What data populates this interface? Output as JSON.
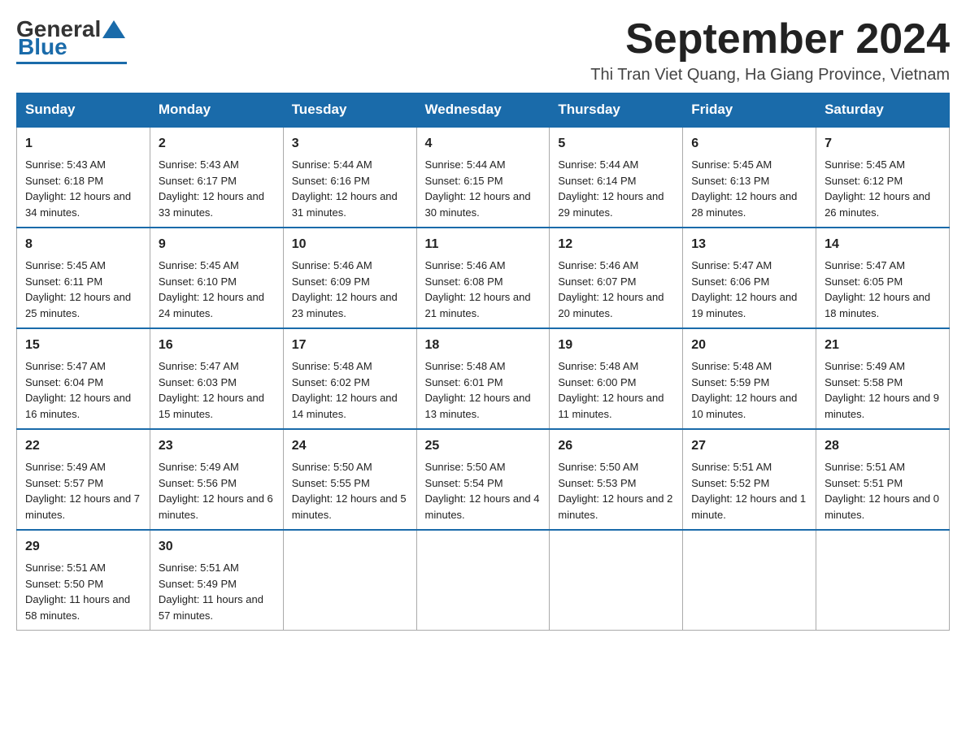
{
  "logo": {
    "general": "General",
    "blue": "Blue"
  },
  "header": {
    "month": "September 2024",
    "location": "Thi Tran Viet Quang, Ha Giang Province, Vietnam"
  },
  "days_of_week": [
    "Sunday",
    "Monday",
    "Tuesday",
    "Wednesday",
    "Thursday",
    "Friday",
    "Saturday"
  ],
  "weeks": [
    [
      {
        "day": "1",
        "sunrise": "Sunrise: 5:43 AM",
        "sunset": "Sunset: 6:18 PM",
        "daylight": "Daylight: 12 hours and 34 minutes."
      },
      {
        "day": "2",
        "sunrise": "Sunrise: 5:43 AM",
        "sunset": "Sunset: 6:17 PM",
        "daylight": "Daylight: 12 hours and 33 minutes."
      },
      {
        "day": "3",
        "sunrise": "Sunrise: 5:44 AM",
        "sunset": "Sunset: 6:16 PM",
        "daylight": "Daylight: 12 hours and 31 minutes."
      },
      {
        "day": "4",
        "sunrise": "Sunrise: 5:44 AM",
        "sunset": "Sunset: 6:15 PM",
        "daylight": "Daylight: 12 hours and 30 minutes."
      },
      {
        "day": "5",
        "sunrise": "Sunrise: 5:44 AM",
        "sunset": "Sunset: 6:14 PM",
        "daylight": "Daylight: 12 hours and 29 minutes."
      },
      {
        "day": "6",
        "sunrise": "Sunrise: 5:45 AM",
        "sunset": "Sunset: 6:13 PM",
        "daylight": "Daylight: 12 hours and 28 minutes."
      },
      {
        "day": "7",
        "sunrise": "Sunrise: 5:45 AM",
        "sunset": "Sunset: 6:12 PM",
        "daylight": "Daylight: 12 hours and 26 minutes."
      }
    ],
    [
      {
        "day": "8",
        "sunrise": "Sunrise: 5:45 AM",
        "sunset": "Sunset: 6:11 PM",
        "daylight": "Daylight: 12 hours and 25 minutes."
      },
      {
        "day": "9",
        "sunrise": "Sunrise: 5:45 AM",
        "sunset": "Sunset: 6:10 PM",
        "daylight": "Daylight: 12 hours and 24 minutes."
      },
      {
        "day": "10",
        "sunrise": "Sunrise: 5:46 AM",
        "sunset": "Sunset: 6:09 PM",
        "daylight": "Daylight: 12 hours and 23 minutes."
      },
      {
        "day": "11",
        "sunrise": "Sunrise: 5:46 AM",
        "sunset": "Sunset: 6:08 PM",
        "daylight": "Daylight: 12 hours and 21 minutes."
      },
      {
        "day": "12",
        "sunrise": "Sunrise: 5:46 AM",
        "sunset": "Sunset: 6:07 PM",
        "daylight": "Daylight: 12 hours and 20 minutes."
      },
      {
        "day": "13",
        "sunrise": "Sunrise: 5:47 AM",
        "sunset": "Sunset: 6:06 PM",
        "daylight": "Daylight: 12 hours and 19 minutes."
      },
      {
        "day": "14",
        "sunrise": "Sunrise: 5:47 AM",
        "sunset": "Sunset: 6:05 PM",
        "daylight": "Daylight: 12 hours and 18 minutes."
      }
    ],
    [
      {
        "day": "15",
        "sunrise": "Sunrise: 5:47 AM",
        "sunset": "Sunset: 6:04 PM",
        "daylight": "Daylight: 12 hours and 16 minutes."
      },
      {
        "day": "16",
        "sunrise": "Sunrise: 5:47 AM",
        "sunset": "Sunset: 6:03 PM",
        "daylight": "Daylight: 12 hours and 15 minutes."
      },
      {
        "day": "17",
        "sunrise": "Sunrise: 5:48 AM",
        "sunset": "Sunset: 6:02 PM",
        "daylight": "Daylight: 12 hours and 14 minutes."
      },
      {
        "day": "18",
        "sunrise": "Sunrise: 5:48 AM",
        "sunset": "Sunset: 6:01 PM",
        "daylight": "Daylight: 12 hours and 13 minutes."
      },
      {
        "day": "19",
        "sunrise": "Sunrise: 5:48 AM",
        "sunset": "Sunset: 6:00 PM",
        "daylight": "Daylight: 12 hours and 11 minutes."
      },
      {
        "day": "20",
        "sunrise": "Sunrise: 5:48 AM",
        "sunset": "Sunset: 5:59 PM",
        "daylight": "Daylight: 12 hours and 10 minutes."
      },
      {
        "day": "21",
        "sunrise": "Sunrise: 5:49 AM",
        "sunset": "Sunset: 5:58 PM",
        "daylight": "Daylight: 12 hours and 9 minutes."
      }
    ],
    [
      {
        "day": "22",
        "sunrise": "Sunrise: 5:49 AM",
        "sunset": "Sunset: 5:57 PM",
        "daylight": "Daylight: 12 hours and 7 minutes."
      },
      {
        "day": "23",
        "sunrise": "Sunrise: 5:49 AM",
        "sunset": "Sunset: 5:56 PM",
        "daylight": "Daylight: 12 hours and 6 minutes."
      },
      {
        "day": "24",
        "sunrise": "Sunrise: 5:50 AM",
        "sunset": "Sunset: 5:55 PM",
        "daylight": "Daylight: 12 hours and 5 minutes."
      },
      {
        "day": "25",
        "sunrise": "Sunrise: 5:50 AM",
        "sunset": "Sunset: 5:54 PM",
        "daylight": "Daylight: 12 hours and 4 minutes."
      },
      {
        "day": "26",
        "sunrise": "Sunrise: 5:50 AM",
        "sunset": "Sunset: 5:53 PM",
        "daylight": "Daylight: 12 hours and 2 minutes."
      },
      {
        "day": "27",
        "sunrise": "Sunrise: 5:51 AM",
        "sunset": "Sunset: 5:52 PM",
        "daylight": "Daylight: 12 hours and 1 minute."
      },
      {
        "day": "28",
        "sunrise": "Sunrise: 5:51 AM",
        "sunset": "Sunset: 5:51 PM",
        "daylight": "Daylight: 12 hours and 0 minutes."
      }
    ],
    [
      {
        "day": "29",
        "sunrise": "Sunrise: 5:51 AM",
        "sunset": "Sunset: 5:50 PM",
        "daylight": "Daylight: 11 hours and 58 minutes."
      },
      {
        "day": "30",
        "sunrise": "Sunrise: 5:51 AM",
        "sunset": "Sunset: 5:49 PM",
        "daylight": "Daylight: 11 hours and 57 minutes."
      },
      null,
      null,
      null,
      null,
      null
    ]
  ]
}
